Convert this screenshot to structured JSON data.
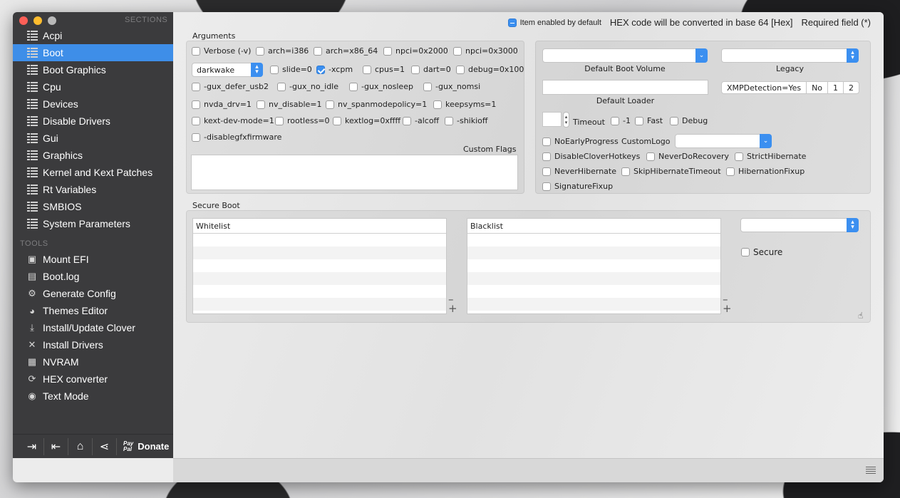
{
  "window": {
    "traffic_colors": [
      "#fc5f57",
      "#fdbc2e",
      "#b9b9b9"
    ]
  },
  "sidebar": {
    "sections_header": "SECTIONS",
    "tools_header": "TOOLS",
    "sections": [
      {
        "label": "Acpi",
        "icon": "list-icon"
      },
      {
        "label": "Boot",
        "icon": "list-icon",
        "selected": true
      },
      {
        "label": "Boot Graphics",
        "icon": "list-icon"
      },
      {
        "label": "Cpu",
        "icon": "list-icon"
      },
      {
        "label": "Devices",
        "icon": "list-icon"
      },
      {
        "label": "Disable Drivers",
        "icon": "list-icon"
      },
      {
        "label": "Gui",
        "icon": "list-icon"
      },
      {
        "label": "Graphics",
        "icon": "list-icon"
      },
      {
        "label": "Kernel and Kext Patches",
        "icon": "list-icon"
      },
      {
        "label": "Rt Variables",
        "icon": "list-icon"
      },
      {
        "label": "SMBIOS",
        "icon": "list-icon"
      },
      {
        "label": "System Parameters",
        "icon": "list-icon"
      }
    ],
    "tools": [
      {
        "label": "Mount EFI",
        "icon": "drive-icon"
      },
      {
        "label": "Boot.log",
        "icon": "document-icon"
      },
      {
        "label": "Generate Config",
        "icon": "gears-icon"
      },
      {
        "label": "Themes Editor",
        "icon": "palette-icon"
      },
      {
        "label": "Install/Update Clover",
        "icon": "download-icon"
      },
      {
        "label": "Install Drivers",
        "icon": "tools-icon"
      },
      {
        "label": "NVRAM",
        "icon": "chip-icon"
      },
      {
        "label": "HEX converter",
        "icon": "refresh-icon"
      },
      {
        "label": "Text Mode",
        "icon": "eye-icon"
      }
    ],
    "bottom": {
      "donate_label": "Donate",
      "paypal_top": "Pay",
      "paypal_bottom": "Pal"
    }
  },
  "header": {
    "item_enabled": "Item enabled by default",
    "hex_note": "HEX code will be converted in base 64 [Hex]",
    "required": "Required field (*)"
  },
  "arguments": {
    "title": "Arguments",
    "row1": [
      {
        "label": "Verbose (-v)",
        "checked": false
      },
      {
        "label": "arch=i386",
        "checked": false
      },
      {
        "label": "arch=x86_64",
        "checked": false
      },
      {
        "label": "npci=0x2000",
        "checked": false
      },
      {
        "label": "npci=0x3000",
        "checked": false
      }
    ],
    "darkwake_value": "darkwake",
    "row2": [
      {
        "label": "slide=0",
        "checked": false
      },
      {
        "label": "-xcpm",
        "checked": true
      },
      {
        "label": "cpus=1",
        "checked": false
      },
      {
        "label": "dart=0",
        "checked": false
      },
      {
        "label": "debug=0x100",
        "checked": false
      }
    ],
    "row3": [
      {
        "label": "-gux_defer_usb2",
        "checked": false
      },
      {
        "label": "-gux_no_idle",
        "checked": false
      },
      {
        "label": "-gux_nosleep",
        "checked": false
      },
      {
        "label": "-gux_nomsi",
        "checked": false
      }
    ],
    "row4": [
      {
        "label": "nvda_drv=1",
        "checked": false
      },
      {
        "label": "nv_disable=1",
        "checked": false
      },
      {
        "label": "nv_spanmodepolicy=1",
        "checked": false
      },
      {
        "label": "keepsyms=1",
        "checked": false
      }
    ],
    "row5": [
      {
        "label": "kext-dev-mode=1",
        "checked": false
      },
      {
        "label": "rootless=0",
        "checked": false
      },
      {
        "label": "kextlog=0xffff",
        "checked": false
      },
      {
        "label": "-alcoff",
        "checked": false
      },
      {
        "label": "-shikioff",
        "checked": false
      }
    ],
    "row6": [
      {
        "label": "-disablegfxfirmware",
        "checked": false
      }
    ],
    "custom_flags_label": "Custom Flags",
    "custom_flags_value": ""
  },
  "boot": {
    "default_volume_label": "Default Boot Volume",
    "default_volume_value": "",
    "legacy_label": "Legacy",
    "legacy_value": "",
    "default_loader_label": "Default Loader",
    "default_loader_value": "",
    "xmp": [
      "XMPDetection=Yes",
      "No",
      "1",
      "2"
    ],
    "timeout_label": "Timeout",
    "timeout_value": "",
    "flags1": [
      {
        "label": "-1",
        "checked": false
      },
      {
        "label": "Fast",
        "checked": false
      },
      {
        "label": "Debug",
        "checked": false
      }
    ],
    "no_early_progress": "NoEarlyProgress",
    "custom_logo_label": "CustomLogo",
    "custom_logo_value": "",
    "flags2": [
      {
        "label": "DisableCloverHotkeys",
        "checked": false
      },
      {
        "label": "NeverDoRecovery",
        "checked": false
      },
      {
        "label": "StrictHibernate",
        "checked": false
      }
    ],
    "flags3": [
      {
        "label": "NeverHibernate",
        "checked": false
      },
      {
        "label": "SkipHibernateTimeout",
        "checked": false
      },
      {
        "label": "HibernationFixup",
        "checked": false
      }
    ],
    "signature_fixup": "SignatureFixup"
  },
  "secure_boot": {
    "title": "Secure Boot",
    "whitelist_header": "Whitelist",
    "blacklist_header": "Blacklist",
    "policy_value": "",
    "secure_label": "Secure"
  }
}
